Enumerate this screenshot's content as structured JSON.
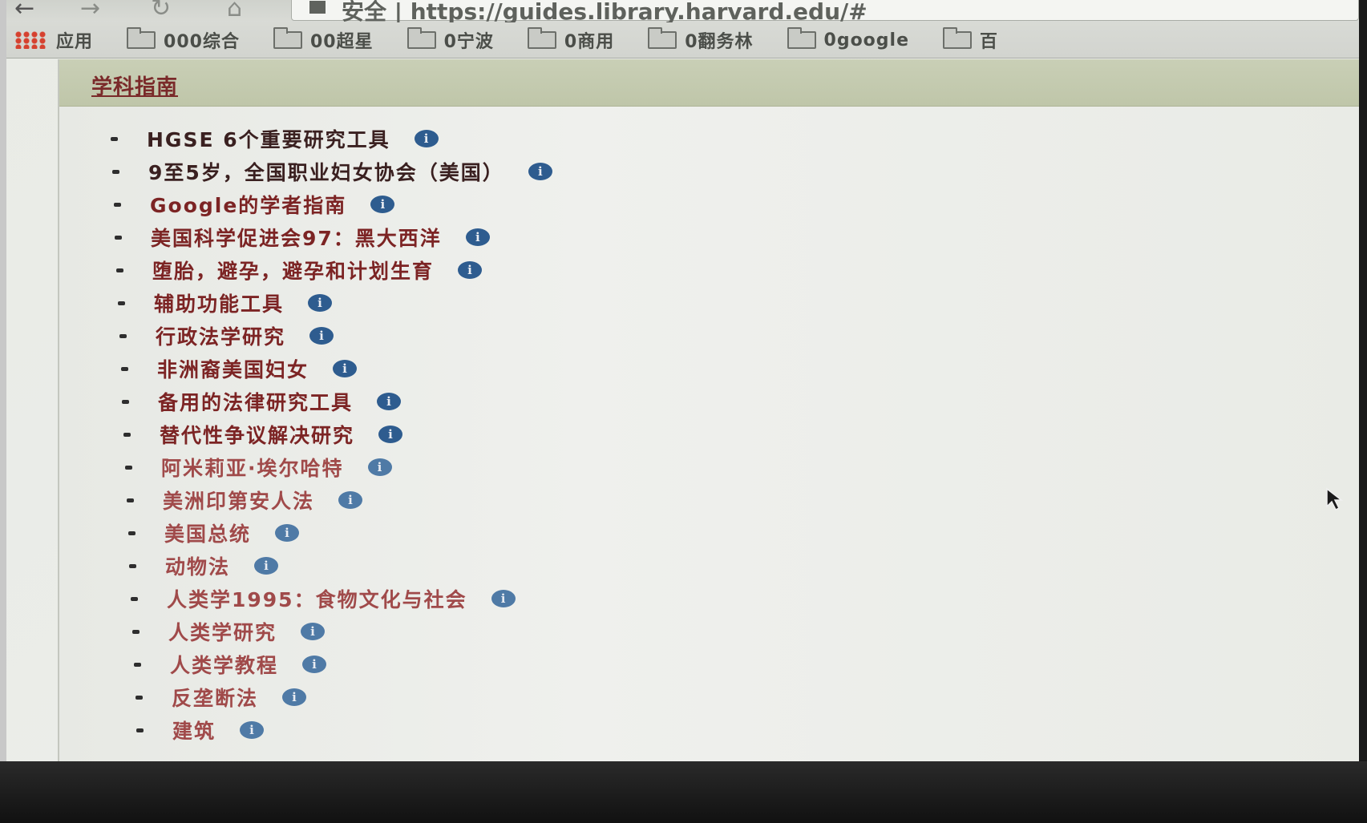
{
  "browser": {
    "nav": {
      "back": "←",
      "forward": "→",
      "reload": "↻",
      "home": "⌂"
    },
    "url_text": "安全 | https://guides.library.harvard.edu/#"
  },
  "bookmarks": [
    {
      "label": "应用",
      "icon": "apps-icon"
    },
    {
      "label": "000综合",
      "icon": "folder-icon"
    },
    {
      "label": "00超星",
      "icon": "folder-icon"
    },
    {
      "label": "0宁波",
      "icon": "folder-icon"
    },
    {
      "label": "0商用",
      "icon": "folder-icon"
    },
    {
      "label": "0翻务林",
      "icon": "folder-icon"
    },
    {
      "label": "0google",
      "icon": "folder-icon"
    },
    {
      "label": "百",
      "icon": "folder-icon"
    }
  ],
  "panel": {
    "title": "学科指南"
  },
  "guides": [
    {
      "label": "HGSE 6个重要研究工具"
    },
    {
      "label": "9至5岁，全国职业妇女协会（美国）"
    },
    {
      "label": "Google的学者指南"
    },
    {
      "label": "美国科学促进会97：黑大西洋"
    },
    {
      "label": "堕胎，避孕，避孕和计划生育"
    },
    {
      "label": "辅助功能工具"
    },
    {
      "label": "行政法学研究"
    },
    {
      "label": "非洲裔美国妇女"
    },
    {
      "label": "备用的法律研究工具"
    },
    {
      "label": "替代性争议解决研究"
    },
    {
      "label": "阿米莉亚·埃尔哈特"
    },
    {
      "label": "美洲印第安人法"
    },
    {
      "label": "美国总统"
    },
    {
      "label": "动物法"
    },
    {
      "label": "人类学1995：食物文化与社会"
    },
    {
      "label": "人类学研究"
    },
    {
      "label": "人类学教程"
    },
    {
      "label": "反垄断法"
    },
    {
      "label": "建筑"
    }
  ],
  "info_glyph": "i",
  "colors": {
    "link": "#7c2424",
    "info_icon": "#2e5c8f",
    "header_bar": "#c4cbad"
  }
}
